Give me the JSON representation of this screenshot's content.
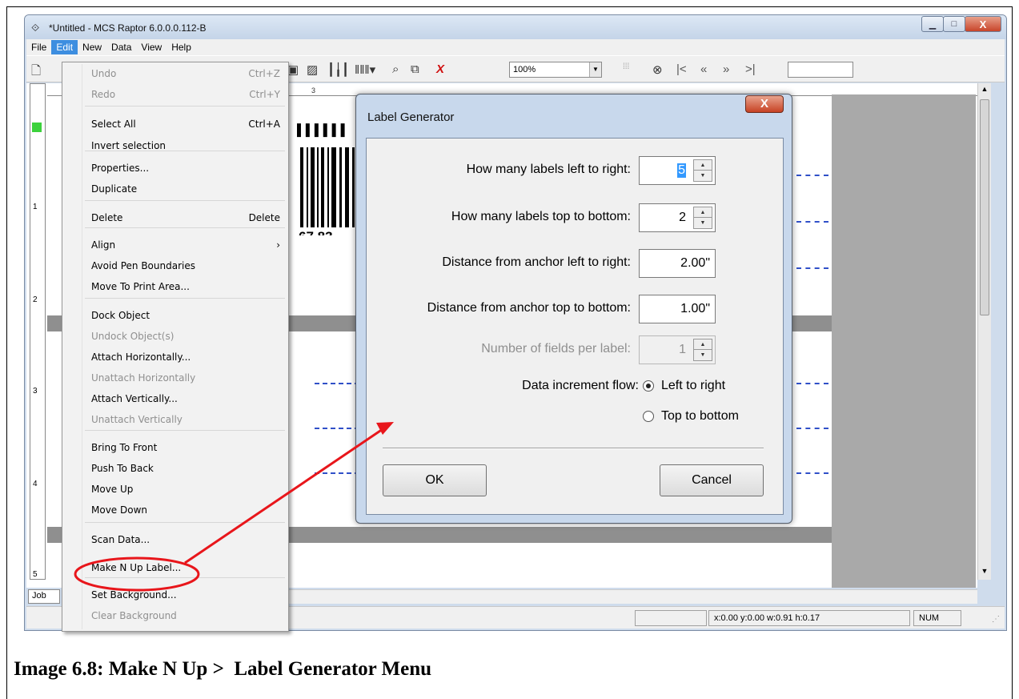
{
  "window": {
    "title": "*Untitled - MCS Raptor 6.0.0.0.112-B",
    "app_icon": "raptor-logo-icon",
    "controls": [
      "minimize-icon",
      "maximize-icon",
      "close-icon"
    ],
    "minimize_glyph": "▁",
    "maximize_glyph": "□",
    "close_glyph": "X"
  },
  "menubar": {
    "items": [
      "File",
      "Edit",
      "New",
      "Data",
      "View",
      "Help"
    ],
    "active": "Edit"
  },
  "toolbar": {
    "zoom_value": "100%"
  },
  "ruler": {
    "v_numbers": [
      "1",
      "2",
      "3",
      "4",
      "5"
    ],
    "h_marker": "3"
  },
  "barcode": {
    "digits": "67 83"
  },
  "edit_menu": {
    "items": [
      {
        "label": "Undo",
        "shortcut": "Ctrl+Z",
        "disabled": true
      },
      {
        "label": "Redo",
        "shortcut": "Ctrl+Y",
        "disabled": true
      },
      {
        "label": "Select All",
        "shortcut": "Ctrl+A",
        "disabled": false
      },
      {
        "label": "Invert selection",
        "shortcut": "",
        "disabled": false
      },
      {
        "label": "Properties...",
        "shortcut": "",
        "disabled": false
      },
      {
        "label": "Duplicate",
        "shortcut": "",
        "disabled": false
      },
      {
        "label": "Delete",
        "shortcut": "Delete",
        "disabled": false
      },
      {
        "label": "Align",
        "shortcut": "›",
        "disabled": false
      },
      {
        "label": "Avoid Pen Boundaries",
        "shortcut": "",
        "disabled": false
      },
      {
        "label": "Move To Print Area...",
        "shortcut": "",
        "disabled": false
      },
      {
        "label": "Dock Object",
        "shortcut": "",
        "disabled": false
      },
      {
        "label": "Undock Object(s)",
        "shortcut": "",
        "disabled": true
      },
      {
        "label": "Attach Horizontally...",
        "shortcut": "",
        "disabled": false
      },
      {
        "label": "Unattach Horizontally",
        "shortcut": "",
        "disabled": true
      },
      {
        "label": "Attach Vertically...",
        "shortcut": "",
        "disabled": false
      },
      {
        "label": "Unattach Vertically",
        "shortcut": "",
        "disabled": true
      },
      {
        "label": "Bring To Front",
        "shortcut": "",
        "disabled": false
      },
      {
        "label": "Push To Back",
        "shortcut": "",
        "disabled": false
      },
      {
        "label": "Move Up",
        "shortcut": "",
        "disabled": false
      },
      {
        "label": "Move Down",
        "shortcut": "",
        "disabled": false
      },
      {
        "label": "Scan Data...",
        "shortcut": "",
        "disabled": false
      },
      {
        "label": "Make N Up Label...",
        "shortcut": "",
        "disabled": false
      },
      {
        "label": "Set Background...",
        "shortcut": "",
        "disabled": false
      },
      {
        "label": "Clear Background",
        "shortcut": "",
        "disabled": true
      }
    ]
  },
  "dialog": {
    "title": "Label Generator",
    "close_glyph": "X",
    "rows": [
      {
        "label": "How many labels left to right:",
        "value": "5",
        "spin": true,
        "disabled": false,
        "selected": true
      },
      {
        "label": "How many labels top to bottom:",
        "value": "2",
        "spin": true,
        "disabled": false,
        "selected": false
      },
      {
        "label": "Distance from anchor left to right:",
        "value": "2.00\"",
        "spin": false,
        "disabled": false,
        "selected": false
      },
      {
        "label": "Distance from anchor top to bottom:",
        "value": "1.00\"",
        "spin": false,
        "disabled": false,
        "selected": false
      },
      {
        "label": "Number of fields per label:",
        "value": "1",
        "spin": true,
        "disabled": true,
        "selected": false
      }
    ],
    "flow_label": "Data increment flow:",
    "flow_options": [
      {
        "label": "Left to right",
        "checked": true
      },
      {
        "label": "Top to bottom",
        "checked": false
      }
    ],
    "ok_label": "OK",
    "cancel_label": "Cancel"
  },
  "bottom": {
    "job_tab": "Job",
    "status_coords": "x:0.00 y:0.00 w:0.91 h:0.17",
    "status_num": "NUM"
  },
  "annotation": {
    "color": "#e8161b"
  },
  "caption": "Image 6.8: Make N Up >  Label Generator Menu"
}
